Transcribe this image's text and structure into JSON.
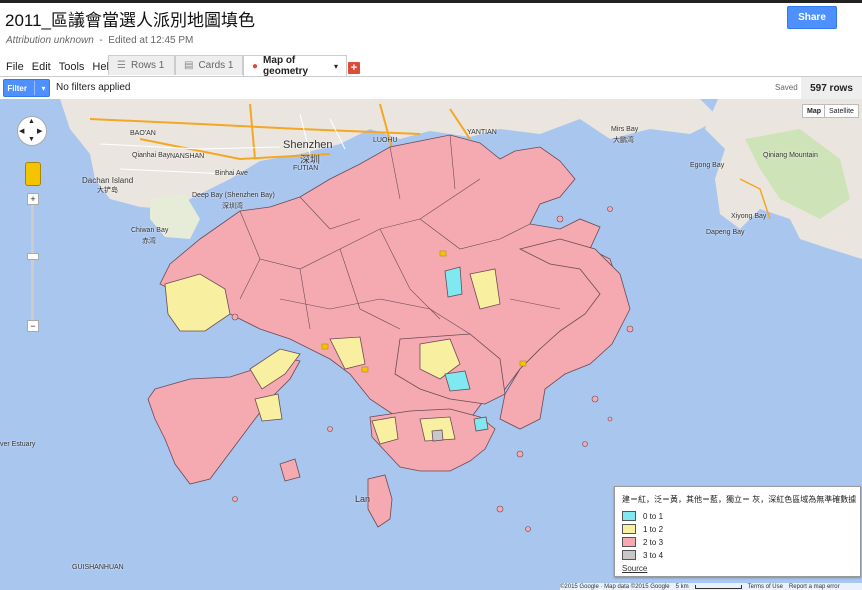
{
  "doc": {
    "title": "2011_區議會當選人派別地圖填色",
    "attribution": "Attribution unknown",
    "edited": "Edited at 12:45 PM",
    "share_label": "Share"
  },
  "menu": [
    "File",
    "Edit",
    "Tools",
    "Help"
  ],
  "tabs": [
    {
      "label": "Rows 1",
      "active": false
    },
    {
      "label": "Cards 1",
      "active": false
    },
    {
      "label": "Map of geometry",
      "active": true
    }
  ],
  "filter": {
    "button_label": "Filter",
    "status": "No filters applied",
    "saved": "Saved",
    "row_count": "597 rows"
  },
  "map": {
    "type_buttons": [
      "Map",
      "Satellite"
    ],
    "legend": {
      "heading": "建＝紅，泛＝黃，其他＝藍，獨立＝ 灰，深紅色區域為無準確數據",
      "items": [
        {
          "label": "0 to 1",
          "color": "#7fe8f0"
        },
        {
          "label": "1 to 2",
          "color": "#f8f0a0"
        },
        {
          "label": "2 to 3",
          "color": "#f4aab0"
        },
        {
          "label": "3 to 4",
          "color": "#c8c8c8"
        }
      ],
      "source_label": "Source"
    },
    "footer": {
      "copyright": "©2015 Google · Map data ©2015 Google",
      "scale": "5 km",
      "terms": "Terms of Use",
      "report": "Report a map error"
    },
    "labels": {
      "shenzhen": "Shenzhen",
      "shenzhen_zh": "深圳",
      "futian": "FUTIAN",
      "luohu": "LUOHU",
      "bao_an": "BAO'AN",
      "nanshan": "NANSHAN",
      "dachan": "Dachan Island",
      "dachan_zh": "大铲岛",
      "qianhai": "Qianhai Bay",
      "binhai": "Binhai Ave",
      "deep_bay": "Deep Bay (Shenzhen Bay)",
      "deep_bay_zh": "深圳湾",
      "chiwan": "Chiwan Bay",
      "chiwan_zh": "赤湾",
      "yantian": "YANTIAN",
      "mirs": "Mirs Bay",
      "mirs_zh": "大鹏湾",
      "qiniang": "Qiniang Mountain",
      "egong": "Egong Bay",
      "xiyong": "Xiyong Bay",
      "dapeng": "Dapeng Bay",
      "river_estuary": "ver Estuary",
      "lantau": "Lan",
      "guishanhuan": "GUISHANHUAN"
    }
  }
}
